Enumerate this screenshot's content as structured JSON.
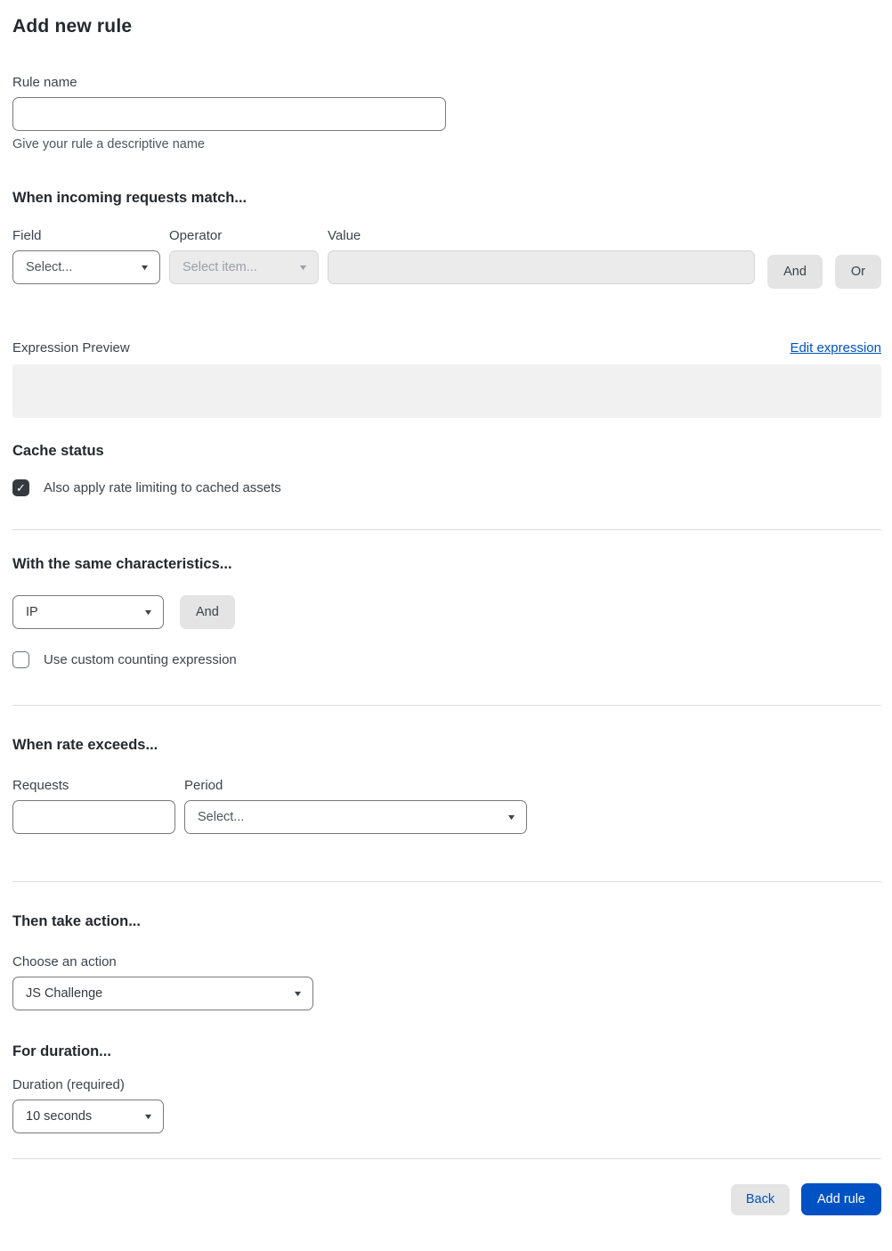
{
  "page": {
    "title": "Add new rule"
  },
  "icons": {
    "check": "✓",
    "chevron": "▼"
  },
  "rule_name": {
    "label": "Rule name",
    "value": "",
    "hint": "Give your rule a descriptive name"
  },
  "match": {
    "heading": "When incoming requests match...",
    "field": {
      "label": "Field",
      "selected": "Select..."
    },
    "operator": {
      "label": "Operator",
      "selected": "Select item..."
    },
    "value": {
      "label": "Value",
      "value": ""
    },
    "and_label": "And",
    "or_label": "Or"
  },
  "expression": {
    "label": "Expression Preview",
    "edit_link": "Edit expression",
    "preview_value": ""
  },
  "cache": {
    "heading": "Cache status",
    "checkbox_label": "Also apply rate limiting to cached assets",
    "checked": true
  },
  "characteristics": {
    "heading": "With the same characteristics...",
    "selected": "IP",
    "and_label": "And",
    "checkbox_label": "Use custom counting expression",
    "checked": false
  },
  "rate": {
    "heading": "When rate exceeds...",
    "requests": {
      "label": "Requests",
      "value": ""
    },
    "period": {
      "label": "Period",
      "selected": "Select..."
    }
  },
  "action": {
    "heading": "Then take action...",
    "label": "Choose an action",
    "selected": "JS Challenge"
  },
  "duration": {
    "heading": "For duration...",
    "label": "Duration (required)",
    "selected": "10 seconds"
  },
  "footer": {
    "back_label": "Back",
    "add_label": "Add rule"
  },
  "colors": {
    "accent_blue": "#0051c3",
    "checkbox_checked": "#36393f",
    "disabled_bg": "#ebebeb",
    "gray_button_bg": "#e4e4e4",
    "preview_bg": "#f1f1f1"
  }
}
